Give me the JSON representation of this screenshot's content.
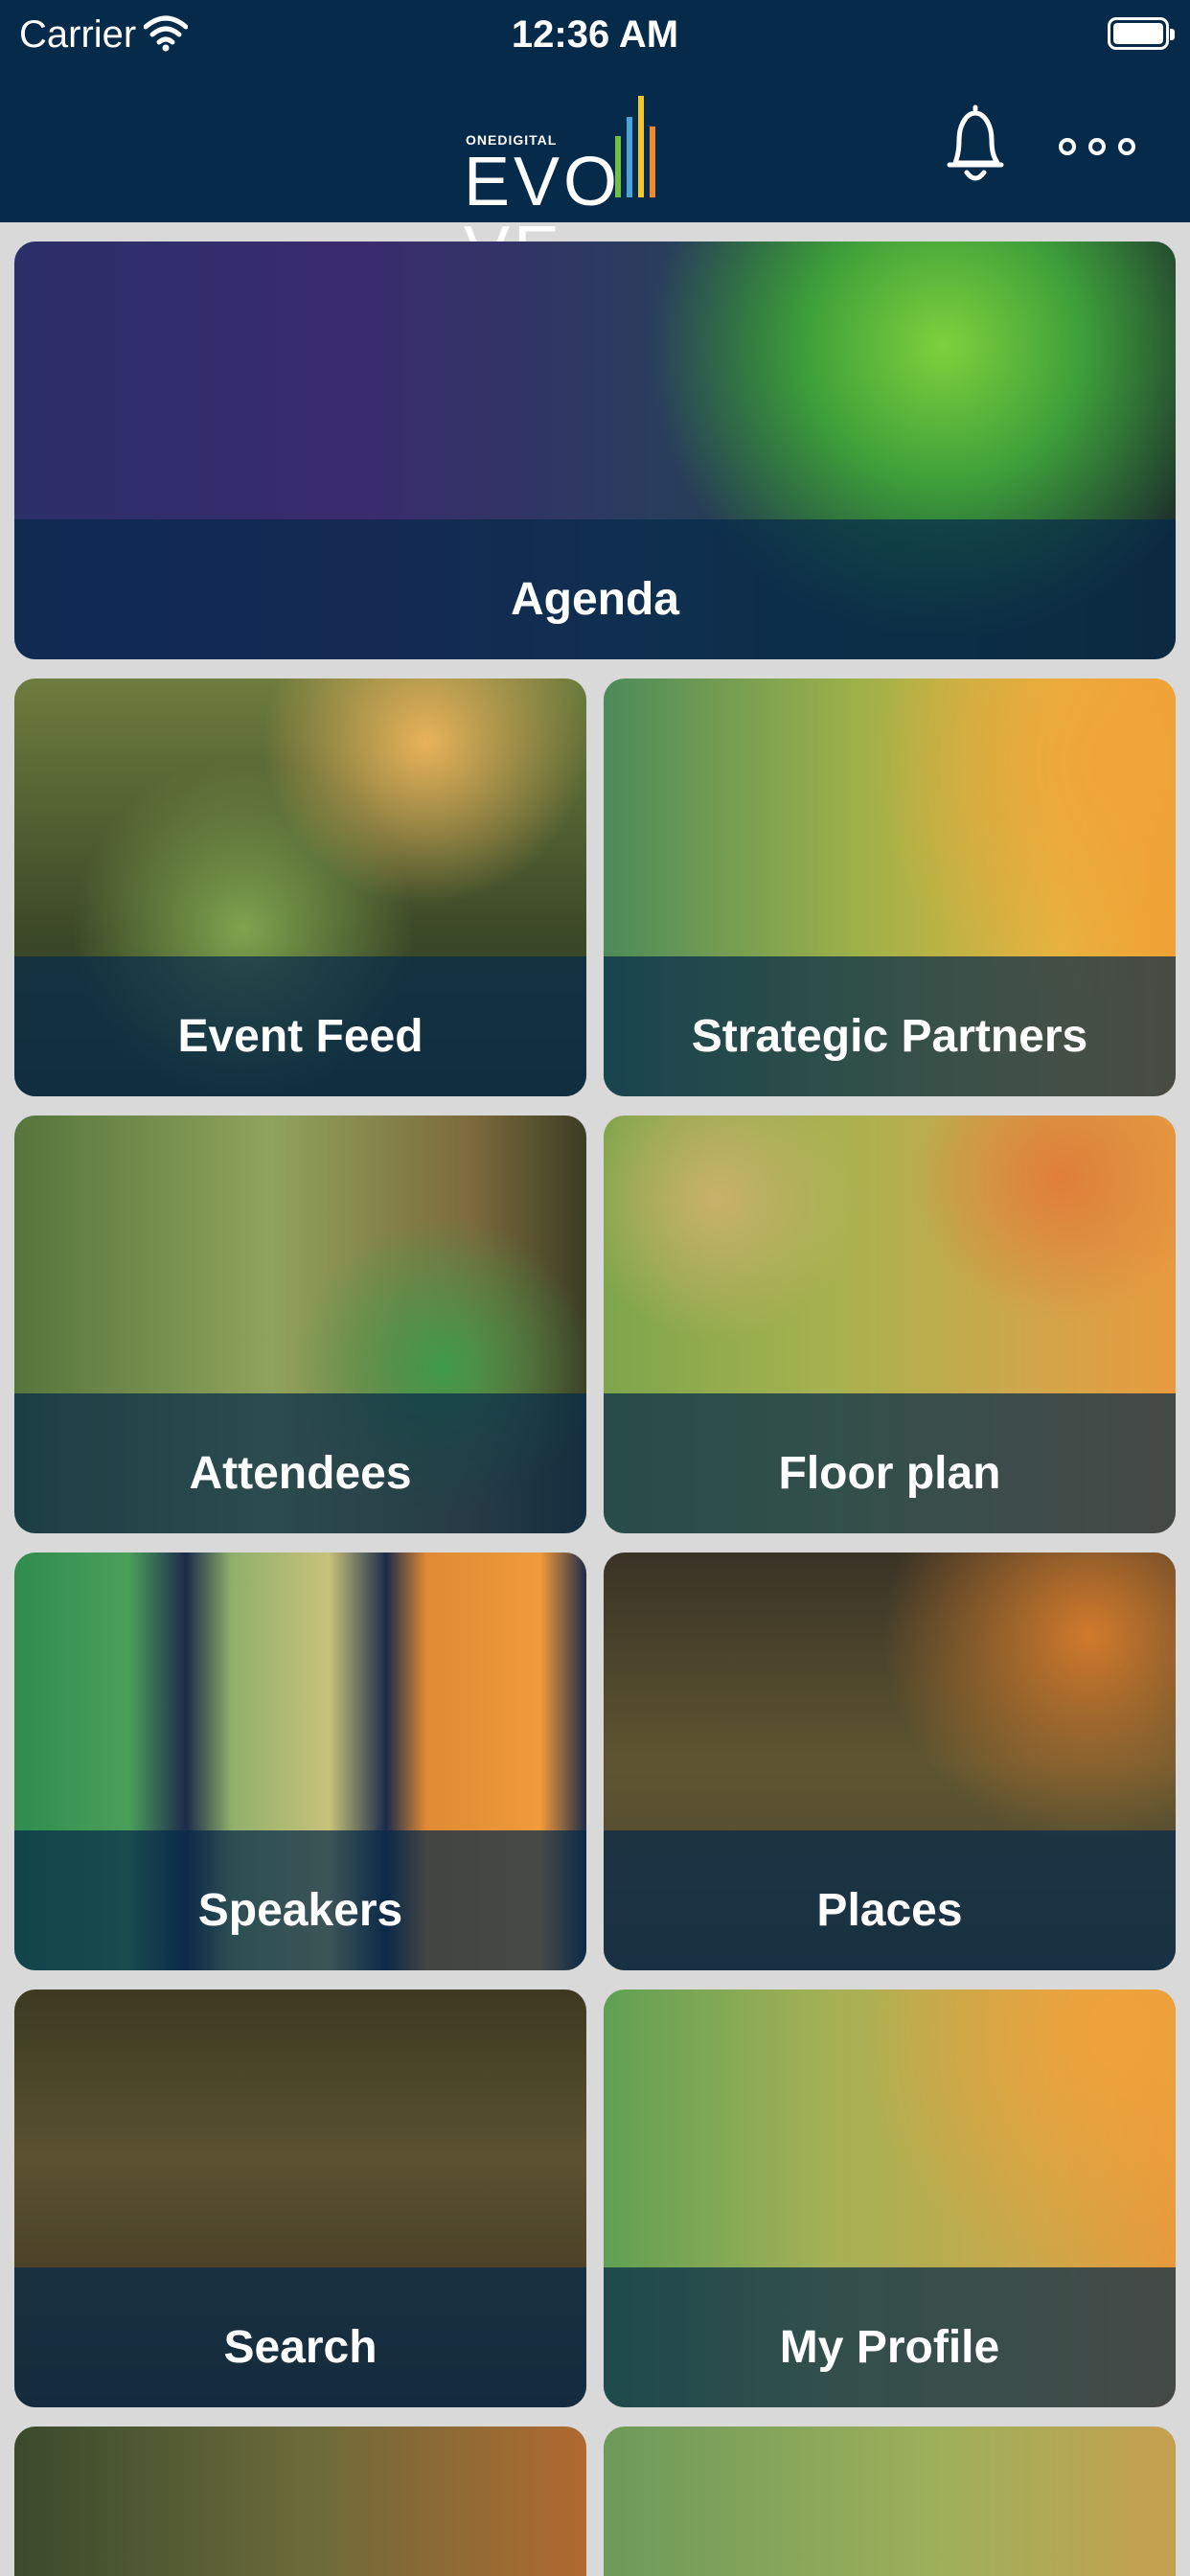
{
  "status_bar": {
    "carrier": "Carrier",
    "time": "12:36 AM"
  },
  "header": {
    "logo_small": "ONEDIGITAL",
    "logo_word": "EVO VE",
    "icons": [
      "bell-icon",
      "more-icon"
    ]
  },
  "tiles": [
    {
      "label": "Agenda"
    },
    {
      "label": "Event Feed"
    },
    {
      "label": "Strategic Partners"
    },
    {
      "label": "Attendees"
    },
    {
      "label": "Floor plan"
    },
    {
      "label": "Speakers"
    },
    {
      "label": "Places"
    },
    {
      "label": "Search"
    },
    {
      "label": "My Profile"
    }
  ],
  "colors": {
    "nav_bg": "#062a49",
    "tile_band": "rgba(6,42,73,0.72)",
    "page_bg": "#d9d9d9"
  }
}
